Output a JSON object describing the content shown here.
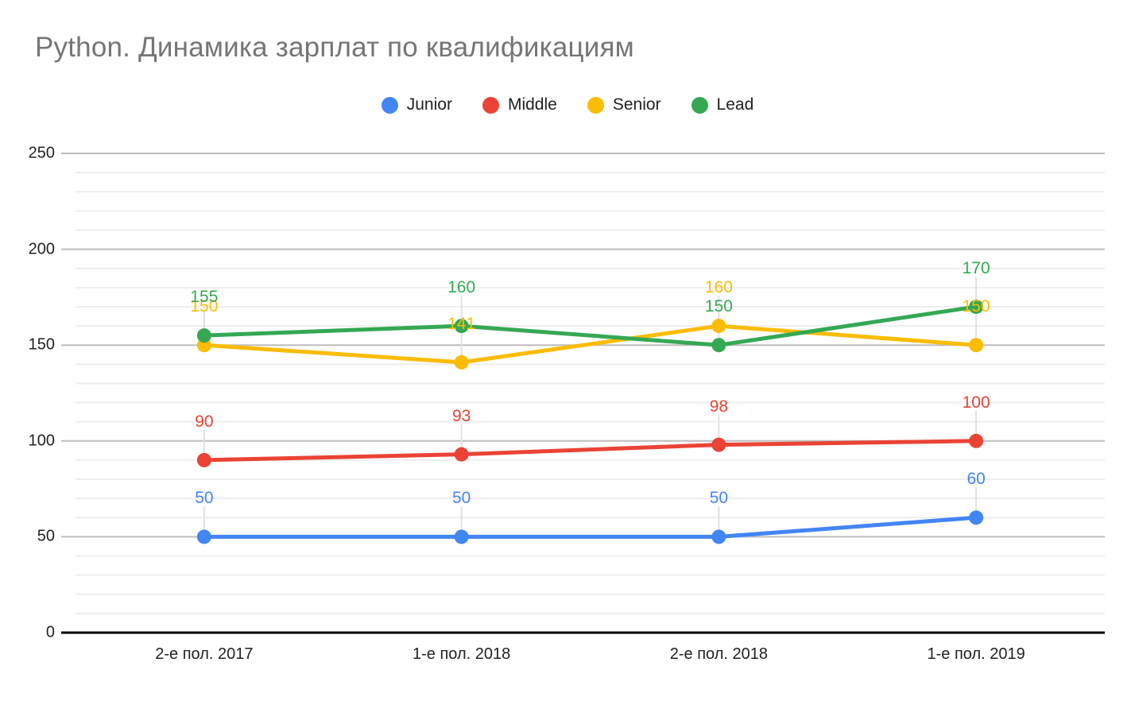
{
  "header": {
    "title": "Python. Динамика зарплат по квалификациям"
  },
  "colors": {
    "junior": "#4285F4",
    "middle": "#EA4335",
    "senior": "#FBBC04",
    "lead": "#34A853",
    "title": "#757575",
    "axis": "#000000",
    "gridline_major": "#BDBDBD",
    "gridline_minor": "#EEEEEE",
    "tick_text": "#222222"
  },
  "legend": {
    "position": "top-center",
    "items": [
      {
        "label": "Junior",
        "color": "#4285F4",
        "icon": "circle-marker-icon"
      },
      {
        "label": "Middle",
        "color": "#EA4335",
        "icon": "circle-marker-icon"
      },
      {
        "label": "Senior",
        "color": "#FBBC04",
        "icon": "circle-marker-icon"
      },
      {
        "label": "Lead",
        "color": "#34A853",
        "icon": "circle-marker-icon"
      }
    ]
  },
  "chart_data": {
    "type": "line",
    "title": "Python. Динамика зарплат по квалификациям",
    "xlabel": "",
    "ylabel": "",
    "ylim": [
      0,
      250
    ],
    "ytick_step": 50,
    "yminor_step": 10,
    "grid": true,
    "legend_position": "top-center",
    "data_labels": true,
    "categories": [
      "2-е пол. 2017",
      "1-е пол. 2018",
      "2-е пол. 2018",
      "1-е пол. 2019"
    ],
    "ytick_labels": [
      "0",
      "50",
      "100",
      "150",
      "200",
      "250"
    ],
    "ytick_values": [
      0,
      50,
      100,
      150,
      200,
      250
    ],
    "series": [
      {
        "name": "Junior",
        "color": "#4285F4",
        "values": [
          50,
          50,
          50,
          60
        ]
      },
      {
        "name": "Middle",
        "color": "#EA4335",
        "values": [
          90,
          93,
          98,
          100
        ]
      },
      {
        "name": "Senior",
        "color": "#FBBC04",
        "values": [
          150,
          141,
          160,
          150
        ]
      },
      {
        "name": "Lead",
        "color": "#34A853",
        "values": [
          155,
          160,
          150,
          170
        ]
      }
    ]
  }
}
